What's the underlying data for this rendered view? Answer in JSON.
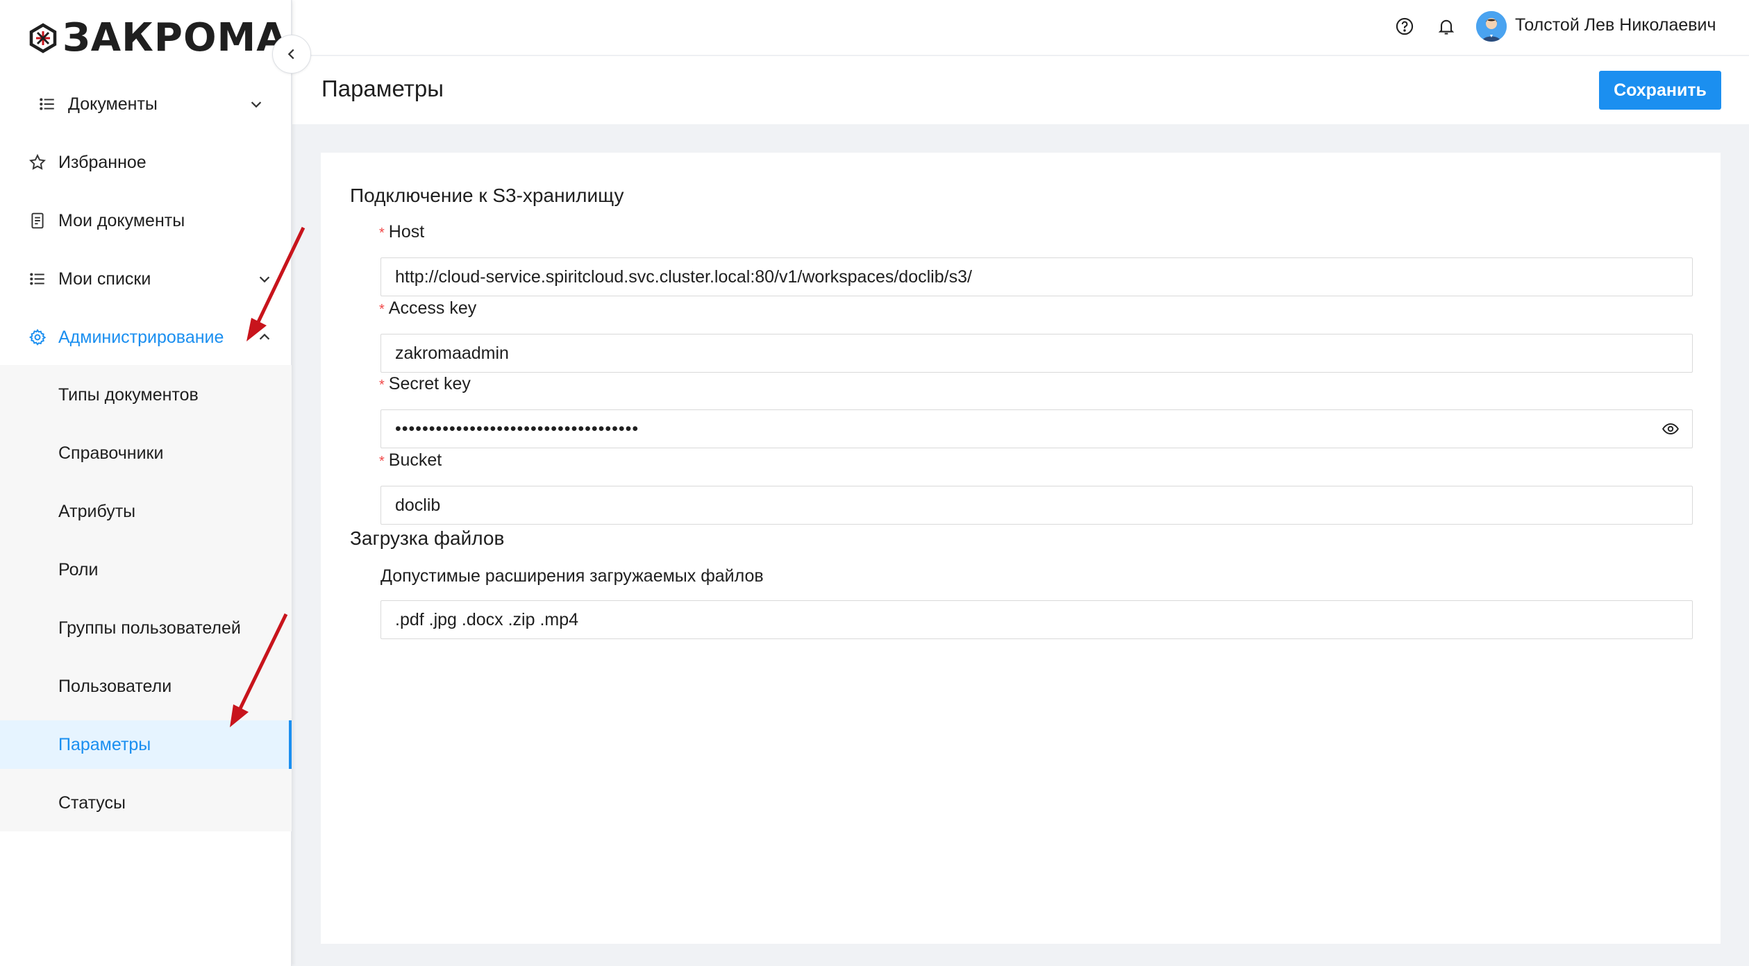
{
  "app": {
    "logo_text": "ЗАКРОМА"
  },
  "header": {
    "help_icon": "help-circle-icon",
    "bell_icon": "bell-icon",
    "user_name": "Толстой Лев Николаевич"
  },
  "sidebar": {
    "items": [
      {
        "label": "Документы",
        "icon": "list-icon"
      },
      {
        "label": "Избранное",
        "icon": "star-icon"
      },
      {
        "label": "Мои документы",
        "icon": "document-icon"
      },
      {
        "label": "Мои списки",
        "icon": "list-icon"
      },
      {
        "label": "Администрирование",
        "icon": "gear-icon"
      }
    ],
    "admin_items": [
      {
        "label": "Типы документов"
      },
      {
        "label": "Справочники"
      },
      {
        "label": "Атрибуты"
      },
      {
        "label": "Роли"
      },
      {
        "label": "Группы пользователей"
      },
      {
        "label": "Пользователи"
      },
      {
        "label": "Параметры"
      },
      {
        "label": "Статусы"
      }
    ],
    "selected": "Параметры"
  },
  "page": {
    "title": "Параметры",
    "save_label": "Сохранить"
  },
  "s3": {
    "section_title": "Подключение к S3-хранилищу",
    "required_mark": "*",
    "host_label": "Host",
    "host_value": "http://cloud-service.spiritcloud.svc.cluster.local:80/v1/workspaces/doclib/s3/",
    "access_key_label": "Access key",
    "access_key_value": "zakromaadmin",
    "secret_key_label": "Secret key",
    "secret_key_value": "••••••••••••••••••••••••••••••••••••",
    "bucket_label": "Bucket",
    "bucket_value": "doclib"
  },
  "upload": {
    "section_title": "Загрузка файлов",
    "extensions_label": "Допустимые расширения загружаемых файлов",
    "extensions_value": ".pdf .jpg .docx .zip .mp4"
  },
  "colors": {
    "accent": "#1b8ff0",
    "required": "#f04848",
    "annotation_arrow": "#c8141c"
  }
}
